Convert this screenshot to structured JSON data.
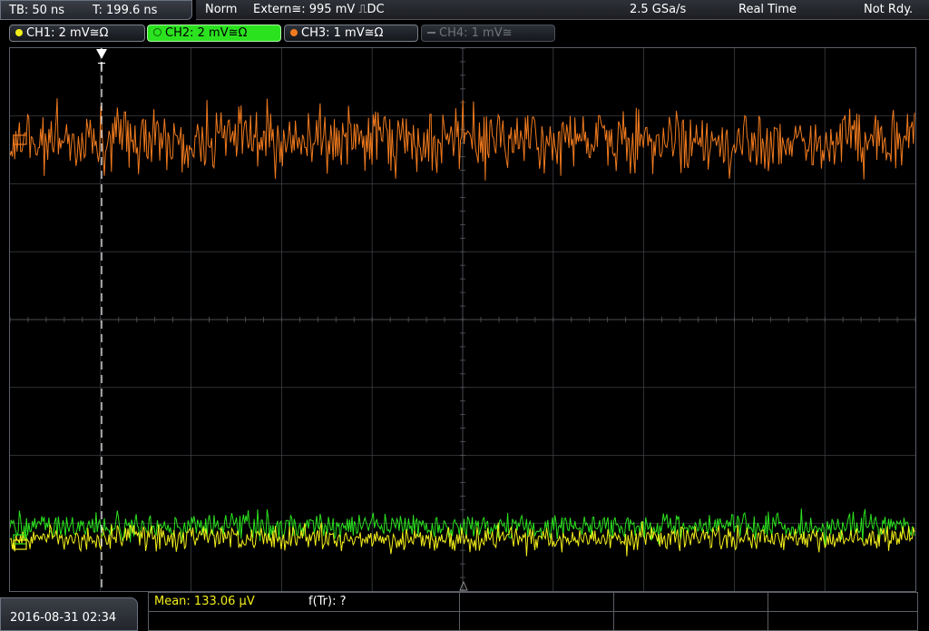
{
  "timebase": {
    "tb": "TB: 50 ns",
    "t": "T: 199.6 ns"
  },
  "status": {
    "mode": "Norm",
    "trigger": "Extern≅: 995 mV ⎍DC",
    "sample_rate": "2.5 GSa/s",
    "acquisition": "Real Time",
    "state": "Not Rdy."
  },
  "channels": [
    {
      "label": "CH1: 2 mV≅Ω",
      "color": "#f2ee1a",
      "active": false,
      "enabled": true
    },
    {
      "label": "CH2: 2 mV≅Ω",
      "color": "#2be21f",
      "active": true,
      "enabled": true
    },
    {
      "label": "CH3: 1 mV≅Ω",
      "color": "#f07a1e",
      "active": false,
      "enabled": true
    },
    {
      "label": "CH4: 1 mV≅",
      "color": "#6f737a",
      "active": false,
      "enabled": false
    }
  ],
  "trigger_marker": "T",
  "footer": {
    "datetime": "2016-08-31 02:34",
    "measurements": [
      {
        "label": "Mean: 133.06 µV",
        "color": "#f2ee1a"
      },
      {
        "label": "f(Tr): ?",
        "color": "#ffffff"
      }
    ]
  },
  "colors": {
    "ch1": "#f2ee1a",
    "ch2": "#2be21f",
    "ch3": "#f07a1e",
    "grid": "#3c3f44"
  }
}
